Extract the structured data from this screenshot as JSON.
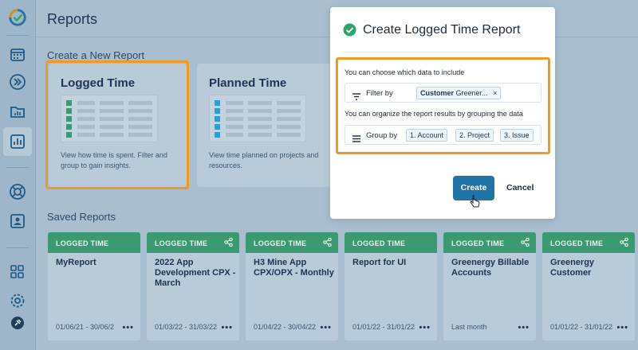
{
  "page": {
    "title": "Reports"
  },
  "create_section": {
    "title": "Create a New Report",
    "cards": [
      {
        "title": "Logged Time",
        "description": "View how time is spent. Filter and group to gain insights.",
        "accent": "#3b9a72"
      },
      {
        "title": "Planned Time",
        "description": "View time planned on projects and resources.",
        "accent": "#2b9ed8"
      }
    ]
  },
  "saved_section": {
    "title": "Saved Reports",
    "cards": [
      {
        "tag": "LOGGED TIME",
        "name": "MyReport",
        "date": "01/06/21 - 30/06/2",
        "shared": false
      },
      {
        "tag": "LOGGED TIME",
        "name": "2022 App Development CPX - March",
        "date": "01/03/22 - 31/03/22",
        "shared": true
      },
      {
        "tag": "LOGGED TIME",
        "name": "H3 Mine App CPX/OPX - Monthly",
        "date": "01/04/22 - 30/04/22",
        "shared": true
      },
      {
        "tag": "LOGGED TIME",
        "name": "Report for UI",
        "date": "01/01/22 - 31/01/22",
        "shared": false
      },
      {
        "tag": "LOGGED TIME",
        "name": "Greenergy Billable Accounts",
        "date": "Last month",
        "shared": true
      },
      {
        "tag": "LOGGED TIME",
        "name": "Greenergy Customer",
        "date": "01/01/22 - 31/01/22",
        "shared": true
      }
    ],
    "more": "•••"
  },
  "modal": {
    "title": "Create Logged Time Report",
    "filter_hint": "You can choose which data to include",
    "filter_label": "Filter by",
    "filter_chip_key": "Customer",
    "filter_chip_value": "Greener...",
    "filter_chip_remove": "×",
    "group_hint": "You can organize the report results by grouping the data",
    "group_label": "Group by",
    "group_chips": [
      "1. Account",
      "2. Project",
      "3. Issue"
    ],
    "create_label": "Create",
    "cancel_label": "Cancel"
  },
  "colors": {
    "highlight": "#f29a1f",
    "primary": "#1f75a7",
    "success": "#2fa36b"
  },
  "icons": [
    "app-logo-icon",
    "calendar-icon",
    "forward-icon",
    "folder-icon",
    "reports-icon",
    "support-icon",
    "user-icon",
    "apps-grid-icon",
    "settings-icon",
    "pin-icon",
    "share-icon",
    "check-circle-icon",
    "filter-icon",
    "group-icon",
    "pointer-cursor-icon"
  ]
}
